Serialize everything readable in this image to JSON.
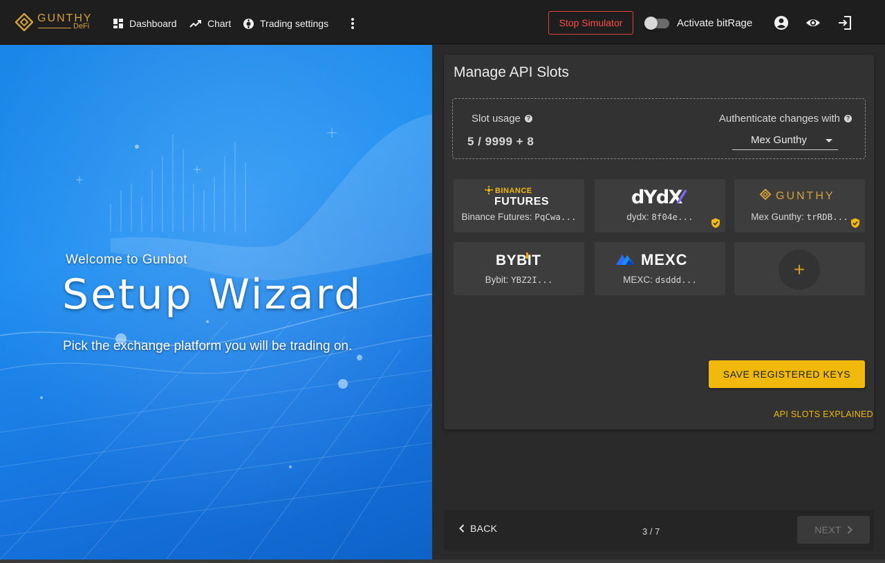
{
  "app": {
    "logo_word": "GUNTHY",
    "logo_sub": "DeFi",
    "accent": "#f0b90b"
  },
  "nav": {
    "items": [
      {
        "label": "Dashboard",
        "icon": "dashboard-icon"
      },
      {
        "label": "Chart",
        "icon": "trending-up-icon"
      },
      {
        "label": "Trading settings",
        "icon": "settings-icon"
      }
    ],
    "more_icon": "more-vert-icon"
  },
  "toolbar": {
    "stop_label": "Stop Simulator",
    "toggle_label": "Activate bitRage",
    "toggle_on": false,
    "icons": [
      "account-icon",
      "eye-icon",
      "logout-icon"
    ]
  },
  "hero": {
    "welcome": "Welcome to Gunbot",
    "title": "Setup Wizard",
    "subtitle": "Pick the exchange platform you will be trading on."
  },
  "card": {
    "title": "Manage API Slots",
    "slot_usage_label": "Slot usage",
    "slot_usage_value": "5 / 9999 + 8",
    "auth_label": "Authenticate changes with",
    "auth_selected": "Mex Gunthy",
    "slots": [
      {
        "brand_top": "BINANCE",
        "brand": "FUTURES",
        "name": "Binance Futures: ",
        "key": "PqCwa...",
        "verified": false
      },
      {
        "brand": "dYdX",
        "name": "dydx: ",
        "key": "8f04e...",
        "verified": true
      },
      {
        "brand": "GUNTHY",
        "name": "Mex Gunthy: ",
        "key": "trRDB...",
        "verified": true
      },
      {
        "brand": "BYBIT",
        "name": "Bybit: ",
        "key": "YBZ2I...",
        "verified": false
      },
      {
        "brand": "MEXC",
        "name": "MEXC: ",
        "key": "dsddd...",
        "verified": false
      }
    ],
    "add_symbol": "+",
    "save_label": "SAVE REGISTERED KEYS",
    "explain_label": "API SLOTS EXPLAINED"
  },
  "footer": {
    "back_label": "BACK",
    "step": "3 / 7",
    "next_label": "NEXT"
  }
}
